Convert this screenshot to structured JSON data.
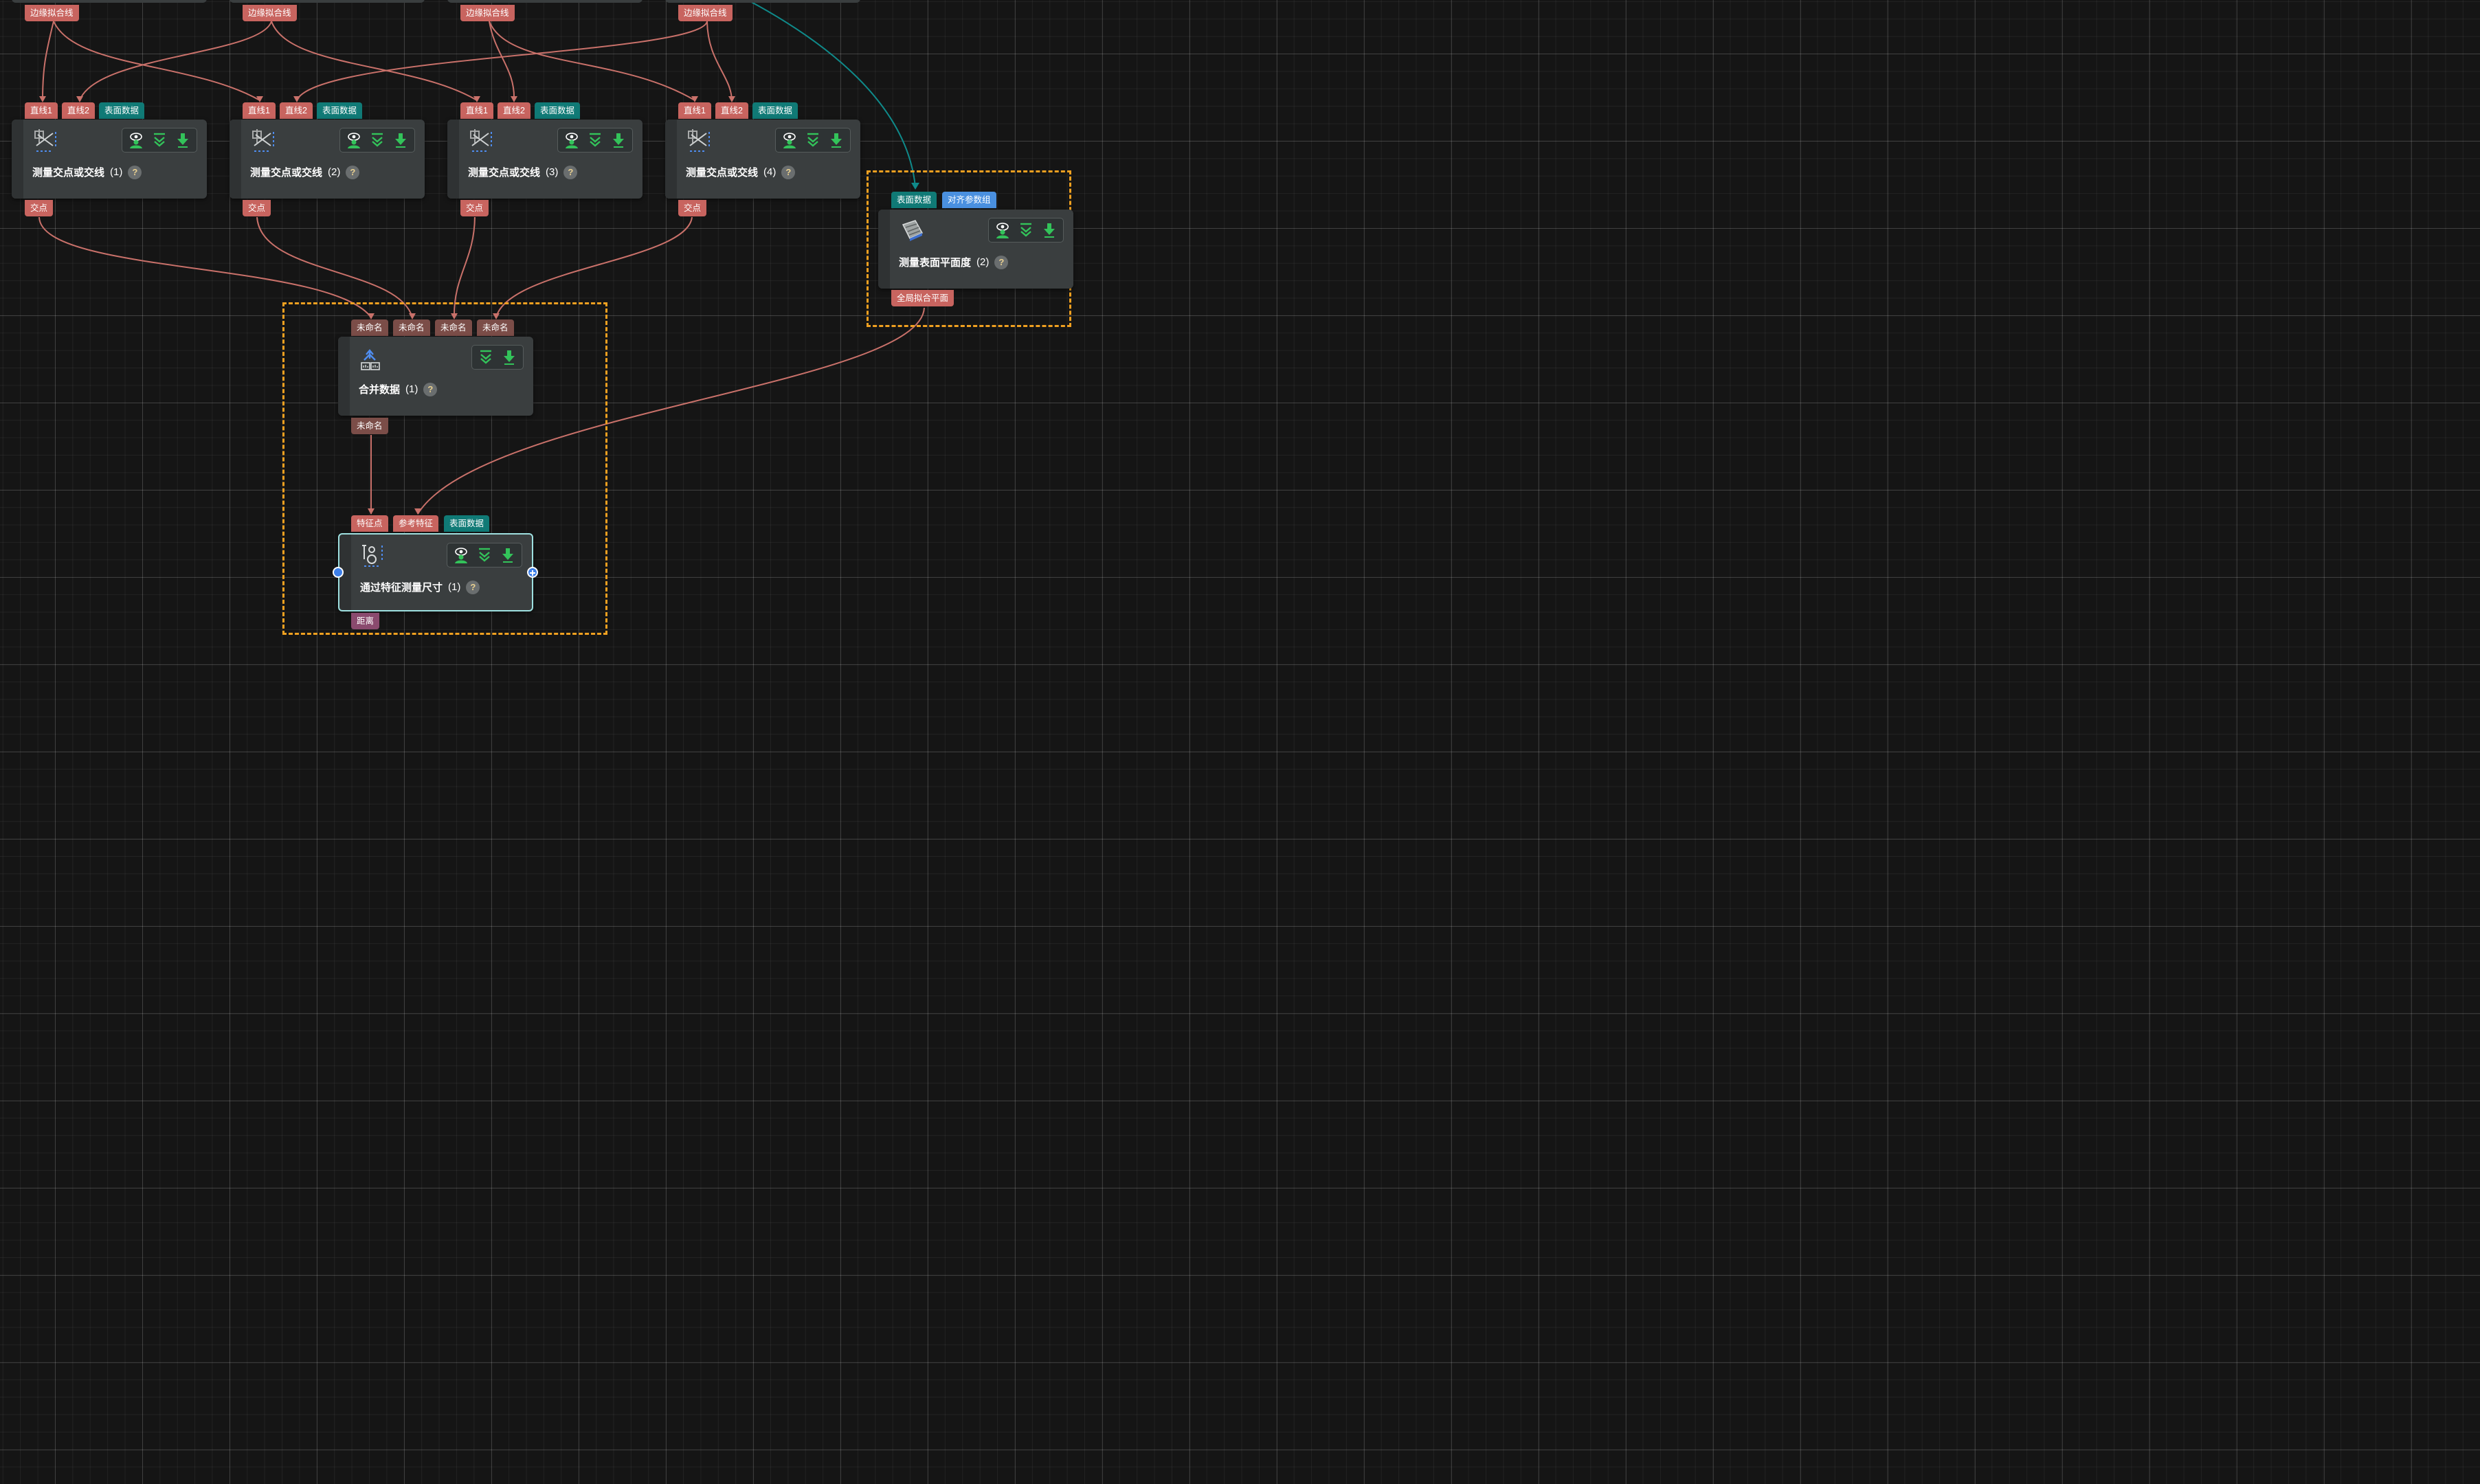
{
  "colors": {
    "canvas_bg": "#151515",
    "node_bg": "#3a3e3f",
    "wire": "#c9716a",
    "wire_teal": "#0f8a8a",
    "port_red": "#c8645f",
    "port_teal": "#107a76",
    "port_blue": "#4a90e0",
    "port_brown": "#7b4d48",
    "port_mauve": "#8a4a6e",
    "selection": "#f0a020",
    "active_border": "#9ee0e0"
  },
  "top_outputs": [
    "边缘拟合线",
    "边缘拟合线",
    "边缘拟合线",
    "边缘拟合线"
  ],
  "measure_nodes": [
    {
      "name": "测量交点或交线",
      "count": "(1)",
      "inputs": [
        "直线1",
        "直线2",
        "表面数据"
      ],
      "output": "交点",
      "buttons": [
        "eye-icon",
        "chevrons-down-icon",
        "download-icon"
      ]
    },
    {
      "name": "测量交点或交线",
      "count": "(2)",
      "inputs": [
        "直线1",
        "直线2",
        "表面数据"
      ],
      "output": "交点",
      "buttons": [
        "eye-icon",
        "chevrons-down-icon",
        "download-icon"
      ]
    },
    {
      "name": "测量交点或交线",
      "count": "(3)",
      "inputs": [
        "直线1",
        "直线2",
        "表面数据"
      ],
      "output": "交点",
      "buttons": [
        "eye-icon",
        "chevrons-down-icon",
        "download-icon"
      ]
    },
    {
      "name": "测量交点或交线",
      "count": "(4)",
      "inputs": [
        "直线1",
        "直线2",
        "表面数据"
      ],
      "output": "交点",
      "buttons": [
        "eye-icon",
        "chevrons-down-icon",
        "download-icon"
      ]
    }
  ],
  "flatness_node": {
    "name": "测量表面平面度",
    "count": "(2)",
    "inputs": [
      "表面数据",
      "对齐参数组"
    ],
    "output": "全局拟合平面"
  },
  "merge_node": {
    "name": "合并数据",
    "count": "(1)",
    "inputs": [
      "未命名",
      "未命名",
      "未命名",
      "未命名"
    ],
    "output": "未命名"
  },
  "feature_node": {
    "name": "通过特征测量尺寸",
    "count": "(1)",
    "inputs": [
      "特征点",
      "参考特征",
      "表面数据"
    ],
    "output": "距离"
  },
  "help_label": "?"
}
